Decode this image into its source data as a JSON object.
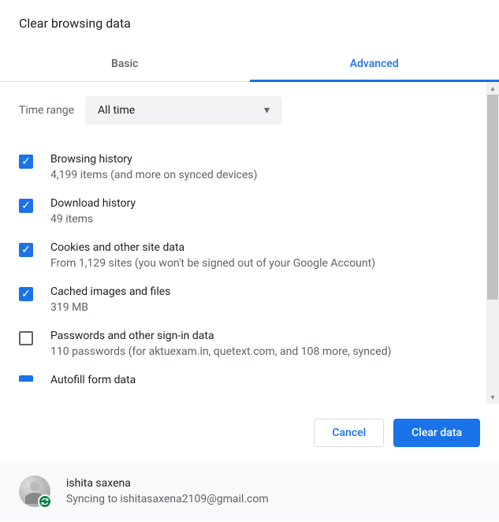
{
  "title": "Clear browsing data",
  "tabs": {
    "basic": "Basic",
    "advanced": "Advanced"
  },
  "timeRange": {
    "label": "Time range",
    "selected": "All time"
  },
  "options": [
    {
      "title": "Browsing history",
      "sub": "4,199 items (and more on synced devices)",
      "checked": true
    },
    {
      "title": "Download history",
      "sub": "49 items",
      "checked": true
    },
    {
      "title": "Cookies and other site data",
      "sub": "From 1,129 sites (you won't be signed out of your Google Account)",
      "checked": true
    },
    {
      "title": "Cached images and files",
      "sub": "319 MB",
      "checked": true
    },
    {
      "title": "Passwords and other sign-in data",
      "sub": "110 passwords (for aktuexam.in, quetext.com, and 108 more, synced)",
      "checked": false
    },
    {
      "title": "Autofill form data",
      "sub": "",
      "checked": true
    }
  ],
  "buttons": {
    "cancel": "Cancel",
    "clear": "Clear data"
  },
  "account": {
    "name": "ishita saxena",
    "sync": "Syncing to ishitasaxena2109@gmail.com"
  }
}
